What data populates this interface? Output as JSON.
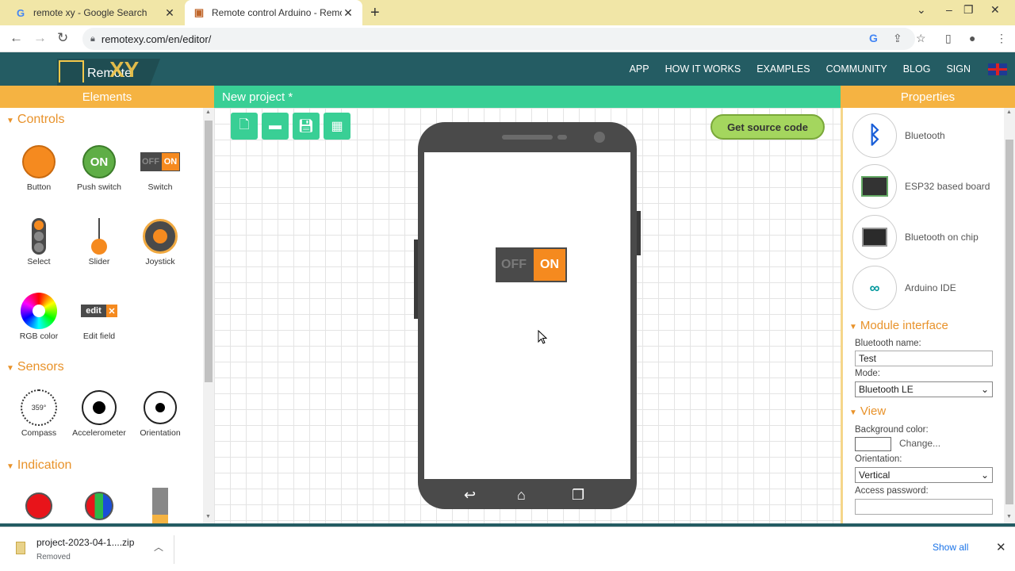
{
  "browser": {
    "tabs": [
      {
        "title": "remote xy - Google Search",
        "icon": "google-icon",
        "active": false
      },
      {
        "title": "Remote control Arduino - Remot",
        "icon": "remotexy-icon",
        "active": true
      }
    ],
    "new_tab": "+",
    "url": "remotexy.com/en/editor/",
    "back": "←",
    "forward": "→",
    "reload": "↻",
    "window_controls": {
      "minimize": "–",
      "restore": "❐",
      "close": "✕",
      "menu": "⌄"
    }
  },
  "site": {
    "logo_text": "Remote",
    "logo_xy": "XY",
    "nav": [
      "APP",
      "HOW IT WORKS",
      "EXAMPLES",
      "COMMUNITY",
      "BLOG",
      "SIGN"
    ],
    "flag": "uk-flag-icon"
  },
  "elements_panel": {
    "title": "Elements",
    "sections": [
      {
        "title": "Controls",
        "items": [
          "Button",
          "Push switch",
          "Switch",
          "Select",
          "Slider",
          "Joystick",
          "RGB color",
          "Edit field"
        ]
      },
      {
        "title": "Sensors",
        "items": [
          "Compass",
          "Accelerometer",
          "Orientation"
        ]
      },
      {
        "title": "Indication",
        "items": []
      }
    ],
    "push_switch_text": "ON",
    "switch_off_text": "OFF",
    "switch_on_text": "ON",
    "edit_field_text": "edit",
    "compass_text": "359°"
  },
  "editor": {
    "project_title": "New project *",
    "get_source_code": "Get source code",
    "toggle_off": "OFF",
    "toggle_on": "ON"
  },
  "properties": {
    "title": "Properties",
    "boards": [
      "Bluetooth",
      "ESP32 based board",
      "Bluetooth on chip",
      "Arduino IDE"
    ],
    "module_interface": {
      "title": "Module interface",
      "bt_name_label": "Bluetooth name:",
      "bt_name_value": "Test",
      "mode_label": "Mode:",
      "mode_value": "Bluetooth LE"
    },
    "view": {
      "title": "View",
      "bg_label": "Background color:",
      "change_label": "Change...",
      "orientation_label": "Orientation:",
      "orientation_value": "Vertical",
      "password_label": "Access password:"
    }
  },
  "downloads": {
    "file_name": "project-2023-04-1....zip",
    "status": "Removed",
    "show_all": "Show all"
  }
}
